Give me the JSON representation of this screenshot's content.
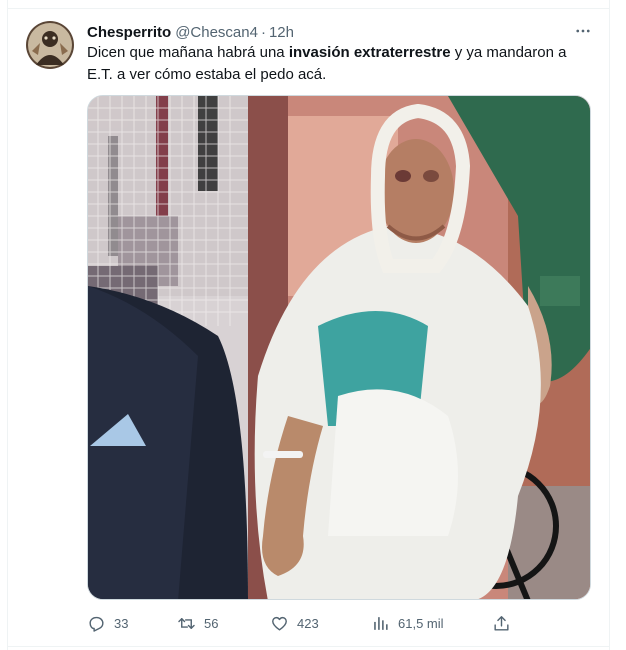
{
  "tweet": {
    "display_name": "Chesperrito",
    "handle": "@Chescan4",
    "separator": "·",
    "time": "12h",
    "text_part1": "Dicen que mañana habrá una ",
    "text_bold": "invasión extraterrestre",
    "text_part2": " y ya mandaron a E.T. a ver cómo estaba el pedo acá."
  },
  "actions": {
    "replies": "33",
    "retweets": "56",
    "likes": "423",
    "views": "61,5 mil"
  },
  "icons": {
    "reply": "reply-icon",
    "retweet": "retweet-icon",
    "like": "heart-icon",
    "views": "views-icon",
    "share": "share-icon",
    "more": "more-icon"
  },
  "colors": {
    "text": "#0f1419",
    "secondary": "#536471",
    "border": "#cfd9de"
  }
}
